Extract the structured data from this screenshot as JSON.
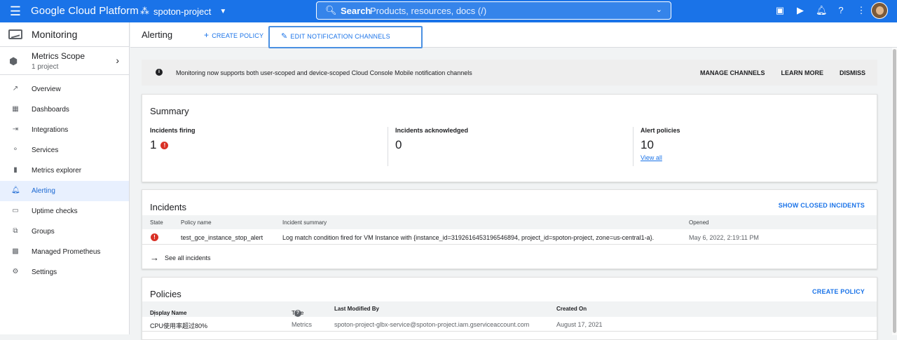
{
  "topbar": {
    "brand": "Google Cloud Platform",
    "project": "spoton-project",
    "search_label": "Search",
    "search_placeholder": "Products, resources, docs (/)"
  },
  "sidebar": {
    "title": "Monitoring",
    "scope_title": "Metrics Scope",
    "scope_subtitle": "1 project",
    "items": [
      {
        "label": "Overview",
        "icon": "overview-icon"
      },
      {
        "label": "Dashboards",
        "icon": "dashboards-icon"
      },
      {
        "label": "Integrations",
        "icon": "integrations-icon"
      },
      {
        "label": "Services",
        "icon": "services-icon"
      },
      {
        "label": "Metrics explorer",
        "icon": "bar-chart-icon"
      },
      {
        "label": "Alerting",
        "icon": "bell-icon",
        "active": true
      },
      {
        "label": "Uptime checks",
        "icon": "monitor-icon"
      },
      {
        "label": "Groups",
        "icon": "groups-icon"
      },
      {
        "label": "Managed Prometheus",
        "icon": "prometheus-icon"
      },
      {
        "label": "Settings",
        "icon": "gear-icon"
      }
    ]
  },
  "header": {
    "title": "Alerting",
    "create_policy": "CREATE POLICY",
    "edit_channels": "EDIT NOTIFICATION CHANNELS"
  },
  "banner": {
    "message": "Monitoring now supports both user-scoped and device-scoped Cloud Console Mobile notification channels",
    "manage": "MANAGE CHANNELS",
    "learn": "LEARN MORE",
    "dismiss": "DISMISS"
  },
  "summary": {
    "title": "Summary",
    "firing_label": "Incidents firing",
    "firing_value": "1",
    "ack_label": "Incidents acknowledged",
    "ack_value": "0",
    "policies_label": "Alert policies",
    "policies_value": "10",
    "view_all": "View all"
  },
  "incidents": {
    "title": "Incidents",
    "show_closed": "SHOW CLOSED INCIDENTS",
    "columns": {
      "state": "State",
      "policy": "Policy name",
      "summary": "Incident summary",
      "opened": "Opened"
    },
    "rows": [
      {
        "policy": "test_gce_instance_stop_alert",
        "summary": "Log match condition fired for VM Instance with {instance_id=3192616453196546894, project_id=spoton-project, zone=us-central1-a}.",
        "opened": "May 6, 2022, 2:19:11 PM"
      }
    ],
    "see_all": "See all incidents"
  },
  "policies": {
    "title": "Policies",
    "create": "CREATE POLICY",
    "columns": {
      "name": "Display Name",
      "type": "Type",
      "modified": "Last Modified By",
      "created": "Created On"
    },
    "rows": [
      {
        "name": "CPU使用率超过80%",
        "type": "Metrics",
        "modified": "spoton-project-glbx-service@spoton-project.iam.gserviceaccount.com",
        "created": "August 17, 2021"
      }
    ]
  },
  "colors": {
    "primary": "#1a73e8",
    "error": "#d93025",
    "active_bg": "#e8f0fe"
  }
}
